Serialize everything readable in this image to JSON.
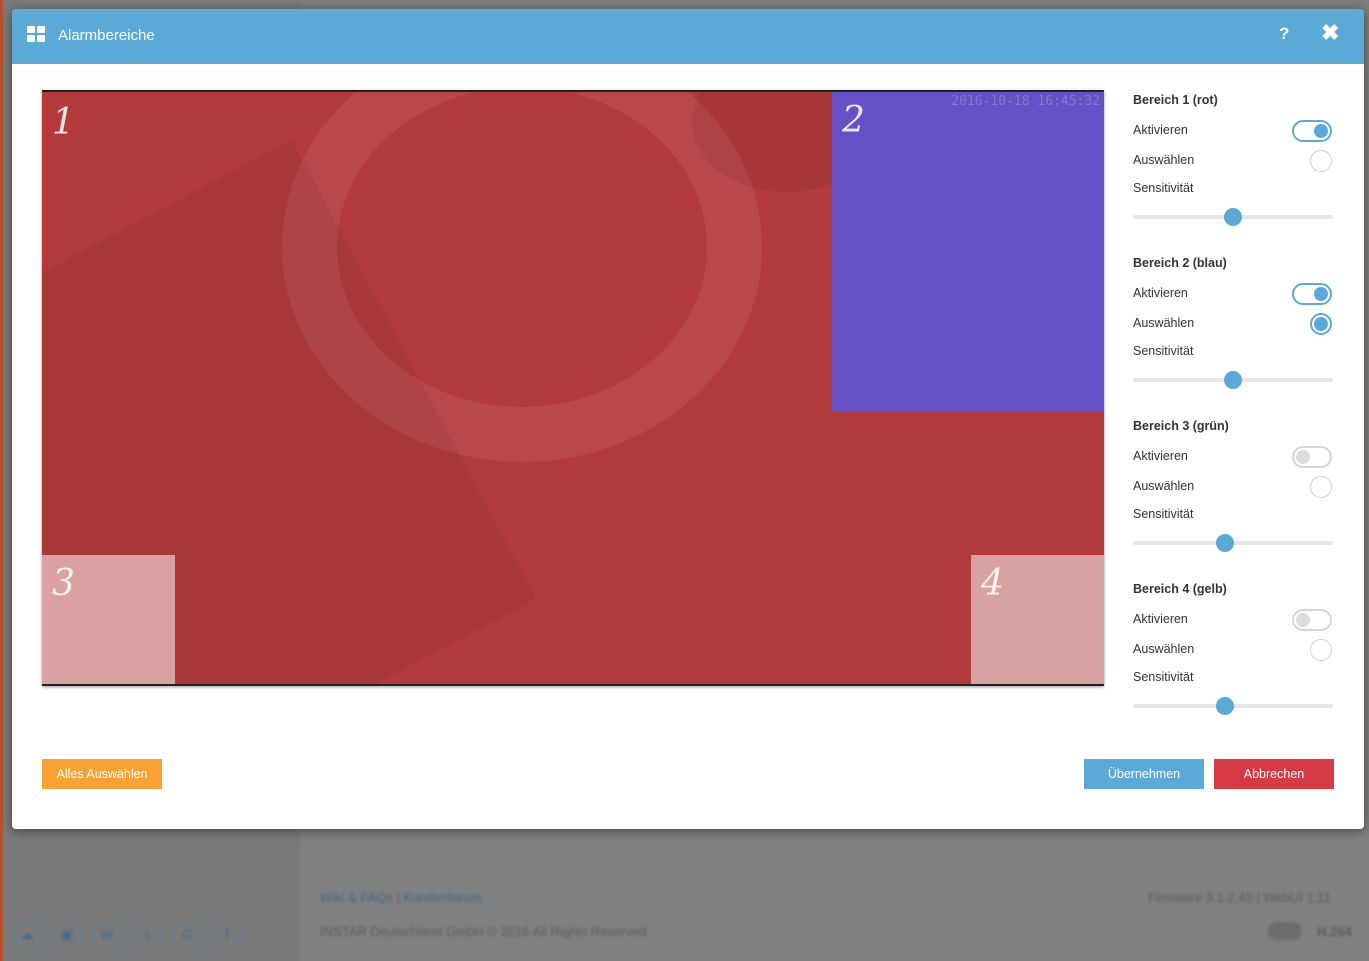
{
  "modal": {
    "title": "Alarmbereiche",
    "help": "?",
    "close": "✖"
  },
  "camera": {
    "timestamp": "2016-10-18 16:45:32",
    "areas": [
      {
        "number": "1",
        "color": "#b23a3b"
      },
      {
        "number": "2",
        "color": "#6550c6"
      },
      {
        "number": "3",
        "color": "#d9a1a1"
      },
      {
        "number": "4",
        "color": "#d9a2a2"
      }
    ]
  },
  "settings": {
    "labels": {
      "activate": "Aktivieren",
      "select": "Auswählen",
      "sensitivity": "Sensitivität"
    },
    "areas": [
      {
        "title": "Bereich 1 (rot)",
        "active": true,
        "selected": false,
        "sensitivity": 0.5
      },
      {
        "title": "Bereich 2 (blau)",
        "active": true,
        "selected": true,
        "sensitivity": 0.5
      },
      {
        "title": "Bereich 3 (grün)",
        "active": false,
        "selected": false,
        "sensitivity": 0.46
      },
      {
        "title": "Bereich 4 (gelb)",
        "active": false,
        "selected": false,
        "sensitivity": 0.46
      }
    ]
  },
  "buttons": {
    "select_all": "Alles Auswählen",
    "apply": "Übernehmen",
    "cancel": "Abbrechen"
  },
  "background": {
    "footer_links": [
      "Wiki & FAQs",
      "|",
      "Kundenforum"
    ],
    "copyright": "INSTAR Deutschland GmbH © 2016 All Rights Reserved",
    "firmware": "Firmware 3.1.2.45 | WebUI 1.11",
    "codec": "H.264",
    "social_icons": [
      "cloud-icon",
      "store-icon",
      "wiki-icon",
      "twitter-icon",
      "google-plus-icon",
      "facebook-icon"
    ]
  },
  "colors": {
    "header": "#5ba9d6",
    "accent": "#5ba9d6",
    "select_all": "#f7a233",
    "cancel": "#d53a45"
  }
}
